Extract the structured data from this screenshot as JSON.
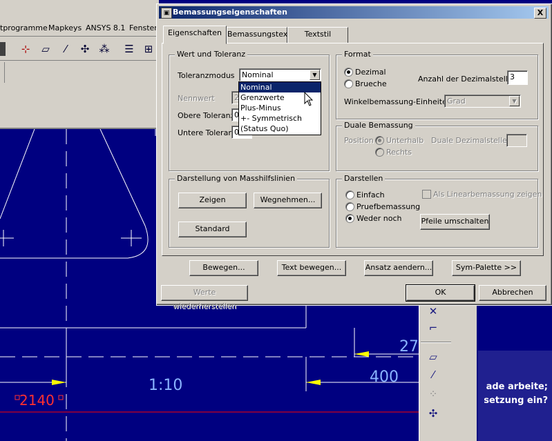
{
  "app": {
    "menu": [
      "tprogramme",
      "Mapkeys",
      "ANSYS 8.1",
      "Fenster"
    ],
    "cad_texts": {
      "dim_1": "1:10",
      "dim_2": "400",
      "dim_3": "27",
      "red_dim": "2140"
    },
    "tip_lines": [
      "ade arbeite;",
      "setzung ein?"
    ]
  },
  "dialog": {
    "title": "Bemassungseigenschaften",
    "close_label": "X",
    "tabs": [
      "Eigenschaften",
      "Bemassungstext",
      "Textstil"
    ],
    "wert": {
      "group_label": "Wert und Toleranz",
      "toleranzmodus_label": "Toleranzmodus",
      "toleranzmodus_value": "Nominal",
      "nennwert_label": "Nennwert",
      "nennwert_value": "2",
      "obere_label": "Obere Toleranz",
      "obere_value": "0",
      "untere_label": "Untere Toleranz",
      "untere_value": "0",
      "options": [
        "Nominal",
        "Grenzwerte",
        "Plus-Minus",
        "+- Symmetrisch",
        "(Status Quo)"
      ]
    },
    "format": {
      "group_label": "Format",
      "dezimal": "Dezimal",
      "brueche": "Brueche",
      "anzahl_label": "Anzahl der Dezimalstellen",
      "anzahl_value": "3",
      "winkel_label": "Winkelbemassung-Einheiten",
      "winkel_value": "Grad"
    },
    "duale": {
      "group_label": "Duale Bemassung",
      "position_label": "Position",
      "unterhalb": "Unterhalb",
      "rechts": "Rechts",
      "dezimal_label": "Duale Dezimalstellen"
    },
    "masshilf": {
      "group_label": "Darstellung von Masshilfslinien",
      "zeigen": "Zeigen",
      "wegnehmen": "Wegnehmen...",
      "standard": "Standard"
    },
    "darstellen": {
      "group_label": "Darstellen",
      "einfach": "Einfach",
      "pruef": "Pruefbemassung",
      "weder": "Weder noch",
      "linear_label": "Als Linearbemassung zeigen",
      "pfeile": "Pfeile umschalten"
    },
    "actions": {
      "bewegen": "Bewegen...",
      "text_bewegen": "Text bewegen...",
      "ansatz": "Ansatz aendern...",
      "sym": "Sym-Palette >>"
    },
    "footer": {
      "werte": "Werte wiederherstellen",
      "ok": "OK",
      "abbrechen": "Abbrechen"
    }
  }
}
